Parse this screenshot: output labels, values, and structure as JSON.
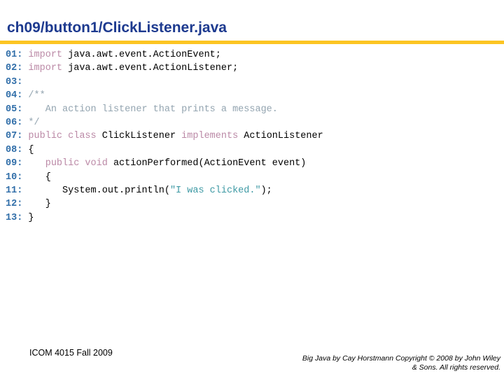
{
  "header": {
    "title": "ch09/button1/ClickListener.java",
    "title_color": "#1d3a8f",
    "rule_color": "#fcc523"
  },
  "code": {
    "language": "java",
    "colors": {
      "line_number": "#2f6da8",
      "keyword": "#bb89a6",
      "comment": "#93a4b0",
      "string": "#3d99a4",
      "plain": "#000000"
    },
    "lines": [
      {
        "number": "01:",
        "tokens": [
          {
            "type": "plain",
            "text": " "
          },
          {
            "type": "keyword",
            "text": "import"
          },
          {
            "type": "plain",
            "text": " java.awt.event.ActionEvent;"
          }
        ]
      },
      {
        "number": "02:",
        "tokens": [
          {
            "type": "plain",
            "text": " "
          },
          {
            "type": "keyword",
            "text": "import"
          },
          {
            "type": "plain",
            "text": " java.awt.event.ActionListener;"
          }
        ]
      },
      {
        "number": "03:",
        "tokens": []
      },
      {
        "number": "04:",
        "tokens": [
          {
            "type": "plain",
            "text": " "
          },
          {
            "type": "comment",
            "text": "/**"
          }
        ]
      },
      {
        "number": "05:",
        "tokens": [
          {
            "type": "plain",
            "text": " "
          },
          {
            "type": "comment",
            "text": "   An action listener that prints a message."
          }
        ]
      },
      {
        "number": "06:",
        "tokens": [
          {
            "type": "plain",
            "text": " "
          },
          {
            "type": "comment",
            "text": "*/"
          }
        ]
      },
      {
        "number": "07:",
        "tokens": [
          {
            "type": "plain",
            "text": " "
          },
          {
            "type": "keyword",
            "text": "public class"
          },
          {
            "type": "plain",
            "text": " ClickListener "
          },
          {
            "type": "keyword",
            "text": "implements"
          },
          {
            "type": "plain",
            "text": " ActionListener"
          }
        ]
      },
      {
        "number": "08:",
        "tokens": [
          {
            "type": "plain",
            "text": " {"
          }
        ]
      },
      {
        "number": "09:",
        "tokens": [
          {
            "type": "plain",
            "text": "    "
          },
          {
            "type": "keyword",
            "text": "public void"
          },
          {
            "type": "plain",
            "text": " actionPerformed(ActionEvent event)"
          }
        ]
      },
      {
        "number": "10:",
        "tokens": [
          {
            "type": "plain",
            "text": "    {"
          }
        ]
      },
      {
        "number": "11:",
        "tokens": [
          {
            "type": "plain",
            "text": "       System.out.println("
          },
          {
            "type": "string",
            "text": "\"I was clicked.\""
          },
          {
            "type": "plain",
            "text": ");"
          }
        ]
      },
      {
        "number": "12:",
        "tokens": [
          {
            "type": "plain",
            "text": "    }"
          }
        ]
      },
      {
        "number": "13:",
        "tokens": [
          {
            "type": "plain",
            "text": " }"
          }
        ]
      }
    ]
  },
  "footer": {
    "course": "ICOM 4015 Fall 2009",
    "copyright_line1": "Big Java by Cay Horstmann Copyright © 2008 by John Wiley",
    "copyright_line2": "& Sons.  All rights reserved."
  }
}
